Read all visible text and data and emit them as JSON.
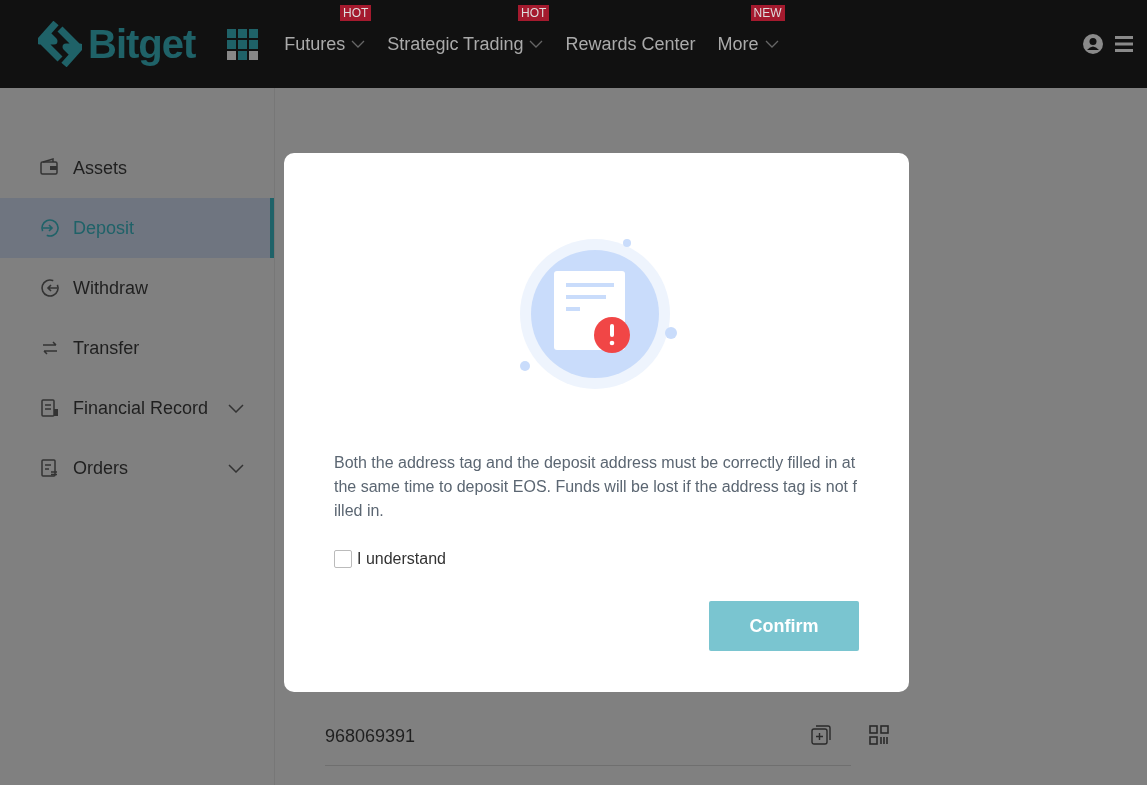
{
  "header": {
    "logo": "Bitget",
    "nav": [
      {
        "label": "Futures",
        "badge": "HOT",
        "dropdown": true
      },
      {
        "label": "Strategic Trading",
        "badge": "HOT",
        "dropdown": true
      },
      {
        "label": "Rewards Center",
        "dropdown": false
      },
      {
        "label": "More",
        "badge": "NEW",
        "dropdown": true
      }
    ]
  },
  "sidebar": {
    "items": [
      {
        "label": "Assets",
        "kind": "wallet",
        "selected": false,
        "expandable": false
      },
      {
        "label": "Deposit",
        "kind": "deposit",
        "selected": true,
        "expandable": false
      },
      {
        "label": "Withdraw",
        "kind": "withdraw",
        "selected": false,
        "expandable": false
      },
      {
        "label": "Transfer",
        "kind": "transfer",
        "selected": false,
        "expandable": false
      },
      {
        "label": "Financial Record",
        "kind": "record",
        "selected": false,
        "expandable": true
      },
      {
        "label": "Orders",
        "kind": "orders",
        "selected": false,
        "expandable": true
      }
    ]
  },
  "tag_field": {
    "value": "968069391"
  },
  "dialog": {
    "message": "Both the address tag and the deposit address must be correctly filled in at the same time to deposit EOS. Funds will be lost if the address tag is not filled in.",
    "checkbox": {
      "label": "I understand",
      "checked": false
    },
    "button": "Confirm"
  }
}
